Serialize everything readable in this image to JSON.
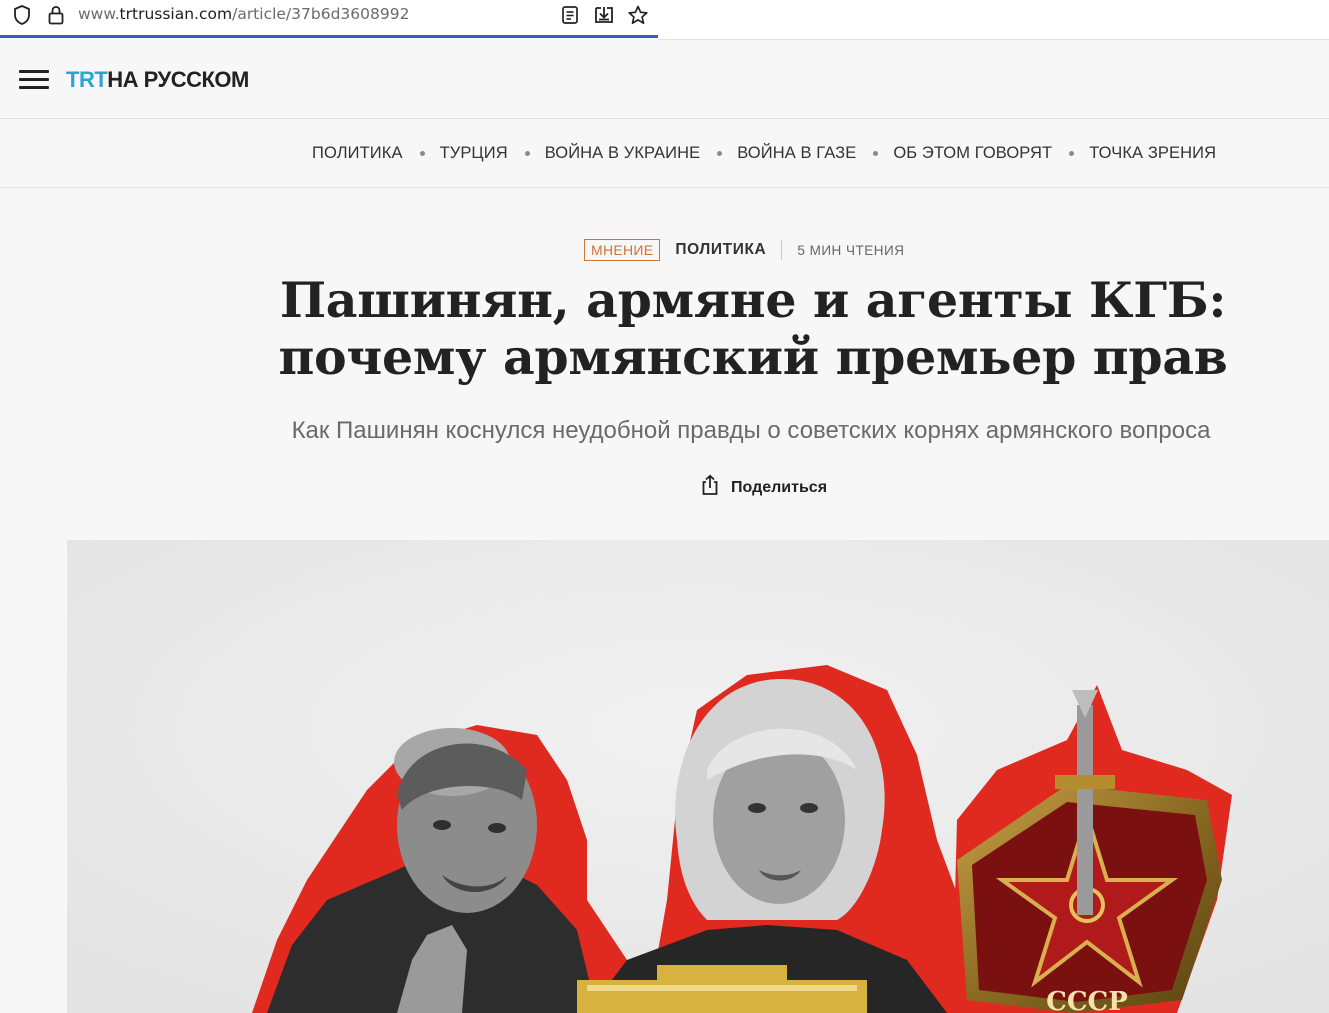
{
  "browser": {
    "url_prefix": "www.",
    "url_host": "trtrussian.com",
    "url_path": "/article/37b6d3608992",
    "icons": [
      "shield-icon",
      "lock-icon",
      "reader-view-icon",
      "save-to-pocket-icon",
      "bookmark-star-icon"
    ]
  },
  "header": {
    "logo_trt": "TRT",
    "logo_ru": "НА РУССКОМ",
    "menu_icon": "hamburger-icon",
    "colors": {
      "trt_blue": "#27a6d4"
    }
  },
  "nav": {
    "items": [
      {
        "label": "ПОЛИТИКА"
      },
      {
        "label": "ТУРЦИЯ"
      },
      {
        "label": "ВОЙНА В УКРАИНЕ"
      },
      {
        "label": "ВОЙНА В ГАЗЕ"
      },
      {
        "label": "ОБ ЭТОМ ГОВОРЯТ"
      },
      {
        "label": "ТОЧКА ЗРЕНИЯ"
      }
    ]
  },
  "article": {
    "badge": "МНЕНИЕ",
    "category": "ПОЛИТИКА",
    "read_time": "5 МИН ЧТЕНИЯ",
    "title": "Пашинян, армяне и агенты КГБ: почему армянский премьер прав",
    "subtitle": "Как Пашинян коснулся неудобной правды о советских корнях армянского вопроса",
    "share_label": "Поделиться",
    "share_icon": "share-icon",
    "badge_color": "#c9763a",
    "hero_badge_text": "СССР"
  }
}
